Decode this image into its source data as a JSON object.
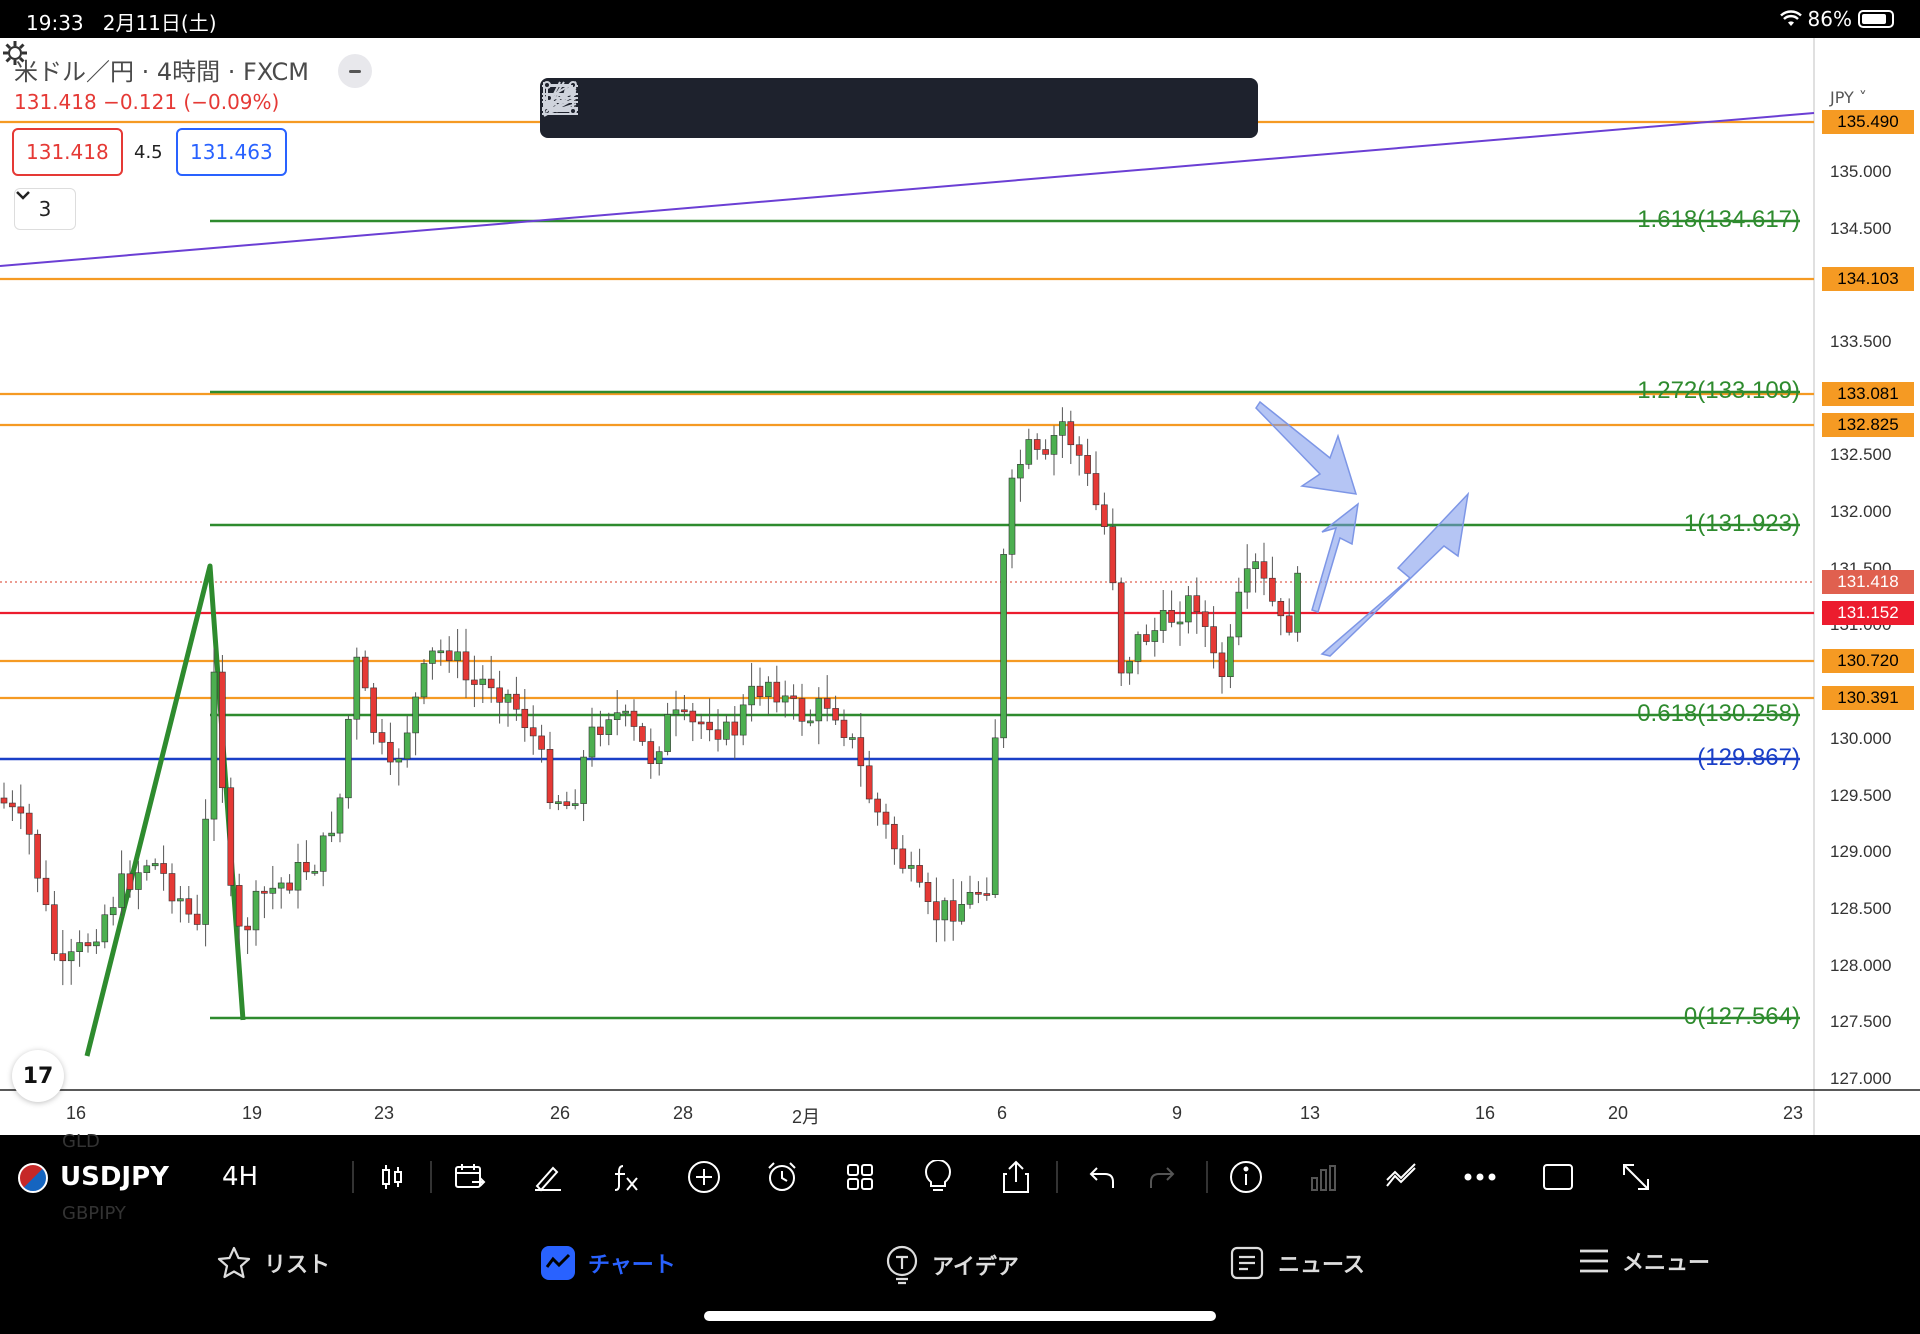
{
  "status": {
    "time": "19:33",
    "date": "2月11日(土)",
    "battery": "86%"
  },
  "header": {
    "title": "米ドル／円 · 4時間 · FXCM",
    "change": "131.418 −0.121 (−0.09%)",
    "bid": "131.418",
    "spread": "4.5",
    "ask": "131.463",
    "indicator_count": "3"
  },
  "drawing_tools": [
    "trend-line",
    "parallel-channel",
    "pitchfork",
    "gann-box",
    "fib-fan",
    "horizontal-ray",
    "horizontal-line",
    "ray",
    "brush",
    "rectangle",
    "arrow"
  ],
  "axis": {
    "currency": "JPY",
    "price_ticks": [
      "135.000",
      "134.500",
      "134.000",
      "133.500",
      "132.500",
      "132.000",
      "131.500",
      "131.000",
      "130.000",
      "129.500",
      "129.000",
      "128.500",
      "128.000",
      "127.500",
      "127.000"
    ],
    "date_ticks": [
      "16",
      "19",
      "23",
      "26",
      "28",
      "2月",
      "6",
      "9",
      "13",
      "16",
      "20",
      "23"
    ]
  },
  "price_labels": [
    {
      "text": "135.490",
      "bg": "#f59a23",
      "fg": "#000000"
    },
    {
      "text": "134.103",
      "bg": "#f59a23",
      "fg": "#000000"
    },
    {
      "text": "133.081",
      "bg": "#f59a23",
      "fg": "#000000"
    },
    {
      "text": "132.825",
      "bg": "#f59a23",
      "fg": "#000000"
    },
    {
      "text": "131.418",
      "bg": "#e0604f",
      "fg": "#ffffff"
    },
    {
      "text": "131.152",
      "bg": "#ec1c2e",
      "fg": "#ffffff"
    },
    {
      "text": "130.720",
      "bg": "#f59a23",
      "fg": "#000000"
    },
    {
      "text": "130.391",
      "bg": "#f59a23",
      "fg": "#000000"
    }
  ],
  "fib_labels": [
    {
      "text": "1.618(134.617)",
      "color": "#2e8b2e"
    },
    {
      "text": "1.272(133.109)",
      "color": "#2e8b2e"
    },
    {
      "text": "1(131.923)",
      "color": "#2e8b2e"
    },
    {
      "text": "0.618(130.258)",
      "color": "#2e8b2e"
    },
    {
      "text": "(129.867)",
      "color": "#1a3fc7"
    },
    {
      "text": "0(127.564)",
      "color": "#2e8b2e"
    }
  ],
  "toolbar": {
    "symbol": "USDJPY",
    "interval": "4H",
    "ghost_above": "GLD",
    "ghost_below": "GBPJPY"
  },
  "tabs": [
    {
      "label": "リスト",
      "icon": "star-icon"
    },
    {
      "label": "チャート",
      "icon": "chart-icon",
      "active": true
    },
    {
      "label": "アイデア",
      "icon": "idea-icon"
    },
    {
      "label": "ニュース",
      "icon": "news-icon"
    },
    {
      "label": "メニュー",
      "icon": "menu-icon"
    }
  ],
  "colors": {
    "accent": "#2962ff",
    "up": "#4caf50",
    "down": "#e53935",
    "fib": "#2e8b2e",
    "level": "#f59a23"
  }
}
